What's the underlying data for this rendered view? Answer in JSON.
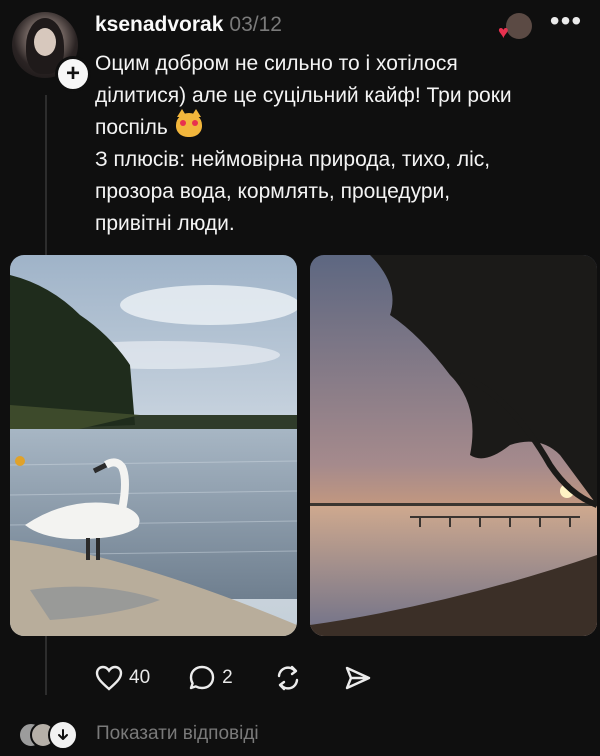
{
  "post": {
    "username": "ksenadvorak",
    "date": "03/12",
    "text_lines": [
      "Оцим добром не сильно то і хотілося",
      "ділитися) але це суцільний кайф! Три роки",
      "поспіль",
      "З плюсів: неймовірна природа, тихо, ліс,",
      "прозора вода, кормлять, процедури,",
      "привітні люди."
    ],
    "emoji": "heart-eyes-cat-emoji"
  },
  "images": [
    {
      "name": "swan-lake-photo"
    },
    {
      "name": "sunset-lake-photo"
    }
  ],
  "actions": {
    "like_count": "40",
    "reply_count": "2"
  },
  "replies": {
    "label": "Показати відповіді"
  },
  "colors": {
    "background": "#0f0f0f",
    "text": "#f3f3f3",
    "muted": "#7a7a7a",
    "heart": "#e8314f"
  }
}
